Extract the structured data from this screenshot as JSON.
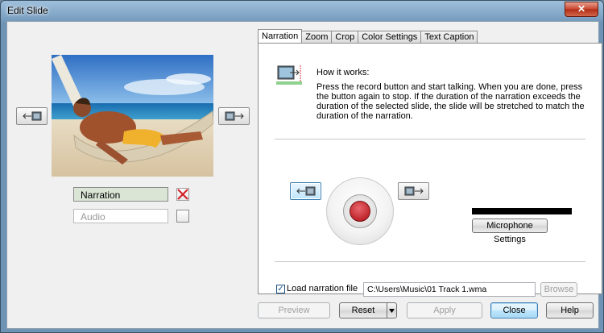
{
  "window": {
    "title": "Edit Slide",
    "close_glyph": "✕"
  },
  "left": {
    "narration_label": "Narration",
    "audio_label": "Audio"
  },
  "tabs": [
    {
      "label": "Narration",
      "selected": true
    },
    {
      "label": "Zoom"
    },
    {
      "label": "Crop"
    },
    {
      "label": "Color Settings"
    },
    {
      "label": "Text Caption"
    }
  ],
  "narration": {
    "how_title": "How it works:",
    "how_text": "Press the record button and start talking. When you are done, press the button again to stop. If the duration of the narration exceeds the duration of the selected slide, the slide will be stretched to match the duration of the narration.",
    "mic_settings_label": "Microphone Settings",
    "load_file_label": "Load narration file",
    "load_file_checked": true,
    "file_path": "C:\\Users\\Music\\01 Track 1.wma",
    "browse_label": "Browse"
  },
  "footer": {
    "preview_label": "Preview",
    "reset_label": "Reset",
    "apply_label": "Apply",
    "close_label": "Close",
    "help_label": "Help"
  },
  "icons": {
    "prev": "arrow-left-slide-icon",
    "next": "arrow-right-slide-icon",
    "remove": "red-x-icon",
    "record": "record-icon"
  },
  "colors": {
    "accent": "#3c7fb1",
    "record": "#c0262d",
    "remove": "#d2232a"
  }
}
